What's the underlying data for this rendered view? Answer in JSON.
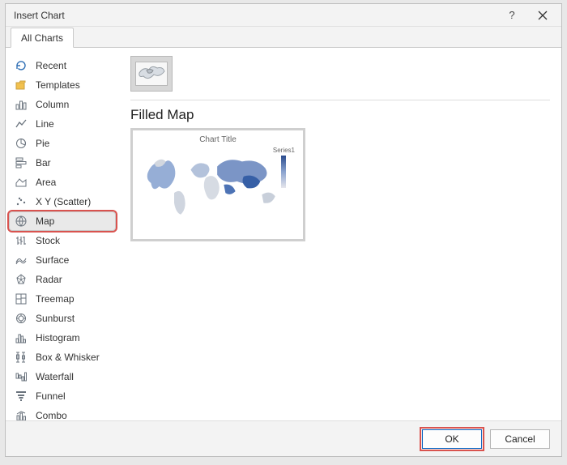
{
  "titlebar": {
    "title": "Insert Chart"
  },
  "tabs": {
    "active": "All Charts"
  },
  "sidebar": {
    "items": [
      {
        "label": "Recent",
        "icon": "recent-icon"
      },
      {
        "label": "Templates",
        "icon": "templates-icon"
      },
      {
        "label": "Column",
        "icon": "column-icon"
      },
      {
        "label": "Line",
        "icon": "line-icon"
      },
      {
        "label": "Pie",
        "icon": "pie-icon"
      },
      {
        "label": "Bar",
        "icon": "bar-icon"
      },
      {
        "label": "Area",
        "icon": "area-icon"
      },
      {
        "label": "X Y (Scatter)",
        "icon": "scatter-icon"
      },
      {
        "label": "Map",
        "icon": "map-icon",
        "selected": true,
        "highlight": true
      },
      {
        "label": "Stock",
        "icon": "stock-icon"
      },
      {
        "label": "Surface",
        "icon": "surface-icon"
      },
      {
        "label": "Radar",
        "icon": "radar-icon"
      },
      {
        "label": "Treemap",
        "icon": "treemap-icon"
      },
      {
        "label": "Sunburst",
        "icon": "sunburst-icon"
      },
      {
        "label": "Histogram",
        "icon": "histogram-icon"
      },
      {
        "label": "Box & Whisker",
        "icon": "box-whisker-icon"
      },
      {
        "label": "Waterfall",
        "icon": "waterfall-icon"
      },
      {
        "label": "Funnel",
        "icon": "funnel-icon"
      },
      {
        "label": "Combo",
        "icon": "combo-icon"
      }
    ]
  },
  "main": {
    "subtype_selected": "filled-map",
    "heading": "Filled Map",
    "preview": {
      "title": "Chart Title",
      "legend_label": "Series1"
    }
  },
  "footer": {
    "ok": "OK",
    "cancel": "Cancel"
  }
}
